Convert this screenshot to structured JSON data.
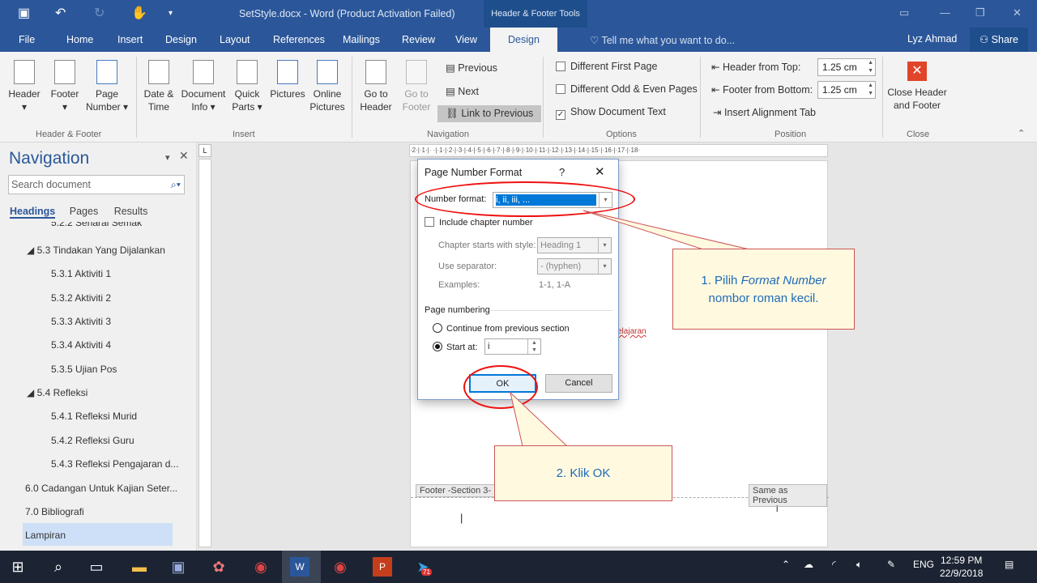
{
  "window": {
    "title": "SetStyle.docx - Word (Product Activation Failed)",
    "context_tab": "Header & Footer Tools",
    "user": "Lyz Ahmad",
    "share": "Share",
    "tell_me": "Tell me what you want to do..."
  },
  "tabs": [
    "File",
    "Home",
    "Insert",
    "Design",
    "Layout",
    "References",
    "Mailings",
    "Review",
    "View",
    "Design"
  ],
  "ribbon": {
    "header": "Header",
    "footer": "Footer",
    "page": "Page",
    "number": "Number",
    "date": "Date &",
    "time": "Time",
    "document": "Document",
    "info": "Info",
    "quick": "Quick",
    "parts": "Parts",
    "pictures": "Pictures",
    "online": "Online",
    "online_pictures": "Pictures",
    "goto": "Go to",
    "goto_header": "Header",
    "goto_footer": "Footer",
    "previous": "Previous",
    "next": "Next",
    "link_prev": "Link to Previous",
    "diff_first": "Different First Page",
    "diff_odd": "Different Odd & Even Pages",
    "show_doc": "Show Document Text",
    "header_top": "Header from Top:",
    "footer_bottom": "Footer from Bottom:",
    "header_val": "1.25 cm",
    "footer_val": "1.25 cm",
    "align_tab": "Insert Alignment Tab",
    "close1": "Close Header",
    "close2": "and Footer",
    "g_hf": "Header & Footer",
    "g_insert": "Insert",
    "g_nav": "Navigation",
    "g_options": "Options",
    "g_position": "Position",
    "g_close": "Close"
  },
  "nav": {
    "title": "Navigation",
    "search": "Search document",
    "tabs": [
      "Headings",
      "Pages",
      "Results"
    ],
    "items": [
      "5.2.2 Senarai Semak",
      "5.3 Tindakan Yang Dijalankan",
      "5.3.1 Aktiviti 1",
      "5.3.2 Aktiviti 2",
      "5.3.3 Aktiviti 3",
      "5.3.4 Aktiviti 4",
      "5.3.5 Ujian Pos",
      "5.4 Refleksi",
      "5.4.1 Refleksi Murid",
      "5.4.2 Refleksi Guru",
      "5.4.3 Refleksi Pengajaran d...",
      "6.0 Cadangan Untuk Kajian Seter...",
      "7.0 Bibliografi",
      "Lampiran"
    ]
  },
  "ruler": "·2·|·1·|· ·|·1·|·2·|·3·|·4·|·5·|·6·|·7·|·8·|·9·|·10·|·11·|·12·|·13·|·14·|·15·|·16·|·17·|·18·",
  "doc": {
    "footer_label": "Footer -Section 3-",
    "same_as_previous": "Same as Previous",
    "page_num": "i",
    "text_fragment": "elajaran"
  },
  "dialog": {
    "title": "Page Number Format",
    "help": "?",
    "number_format_label": "Number format:",
    "number_format_value": "i, ii, iii, ...",
    "include_chapter": "Include chapter number",
    "chapter_style_label": "Chapter starts with style:",
    "chapter_style_value": "Heading 1",
    "separator_label": "Use separator:",
    "separator_value": "-   (hyphen)",
    "examples_label": "Examples:",
    "examples_value": "1-1, 1-A",
    "page_numbering": "Page numbering",
    "continue": "Continue from previous section",
    "start_at": "Start at:",
    "start_value": "i",
    "ok": "OK",
    "cancel": "Cancel"
  },
  "callouts": {
    "c1_line1a": "1. Pilih ",
    "c1_italic": "Format Number",
    "c1_line2": "nombor roman kecil.",
    "c2": "2. Klik OK"
  },
  "taskbar": {
    "lang": "ENG",
    "time": "12:59 PM",
    "date": "22/9/2018",
    "badge": "71"
  }
}
